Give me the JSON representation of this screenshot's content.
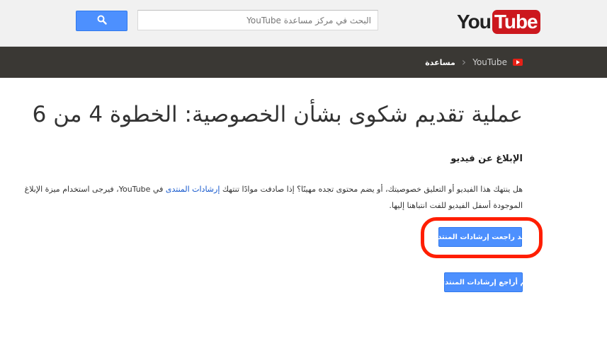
{
  "header": {
    "search_placeholder": "البحث في مركز مساعدة YouTube",
    "search_button_icon": "search-icon",
    "logo": {
      "you": "You",
      "tube": "Tube"
    }
  },
  "breadcrumb": {
    "root": "YouTube",
    "current": "مساعدة",
    "root_icon": "youtube-play-icon"
  },
  "page": {
    "title": "عملية تقديم شكوى بشأن الخصوصية: الخطوة 4 من 6",
    "section_title": "الإبلاغ عن فيديو",
    "paragraph_before_link": "هل ينتهك هذا الفيديو أو التعليق خصوصيتك، أو يضم محتوى تجده مهينًا؟ إذا صادفت موادًا تنتهك ",
    "paragraph_link": "إرشادات المنتدى",
    "paragraph_after_link": " في YouTube، فيرجى استخدام ميزة الإبلاغ الموجودة أسفل الفيديو للفت انتباهنا إليها.",
    "buttons": {
      "reviewed": "لقد راجعت إرشادات المنتدى",
      "not_reviewed": "لم أراجع إرشادات المنتدى"
    }
  },
  "colors": {
    "accent_blue": "#4d90fe",
    "nav_bg": "#3a3834",
    "brand_red": "#cc181e",
    "highlight": "#ff1e00"
  }
}
